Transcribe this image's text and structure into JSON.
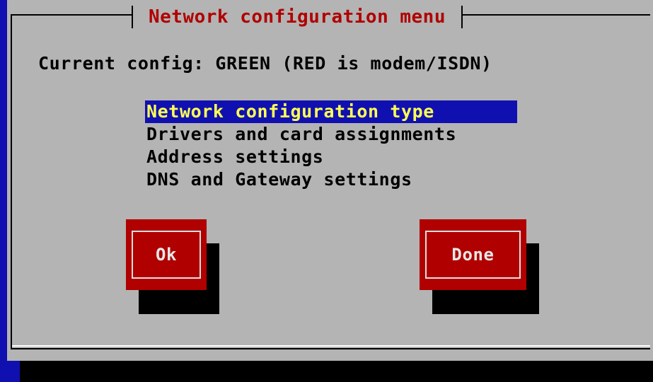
{
  "dialog": {
    "title": "Network configuration menu",
    "current_config": "Current config: GREEN (RED is modem/ISDN)"
  },
  "menu": {
    "items": [
      {
        "label": "Network configuration type",
        "selected": true
      },
      {
        "label": "Drivers and card assignments",
        "selected": false
      },
      {
        "label": "Address settings",
        "selected": false
      },
      {
        "label": "DNS and Gateway settings",
        "selected": false
      }
    ]
  },
  "buttons": {
    "ok_label": "Ok",
    "done_label": "Done"
  },
  "colors": {
    "screen_background": "#1010b0",
    "dialog_background": "#b4b4b4",
    "title_text": "#b00000",
    "selection_background": "#1010b0",
    "selection_text": "#ffff55",
    "button_background": "#b00000",
    "button_text": "#e8e8e8"
  }
}
